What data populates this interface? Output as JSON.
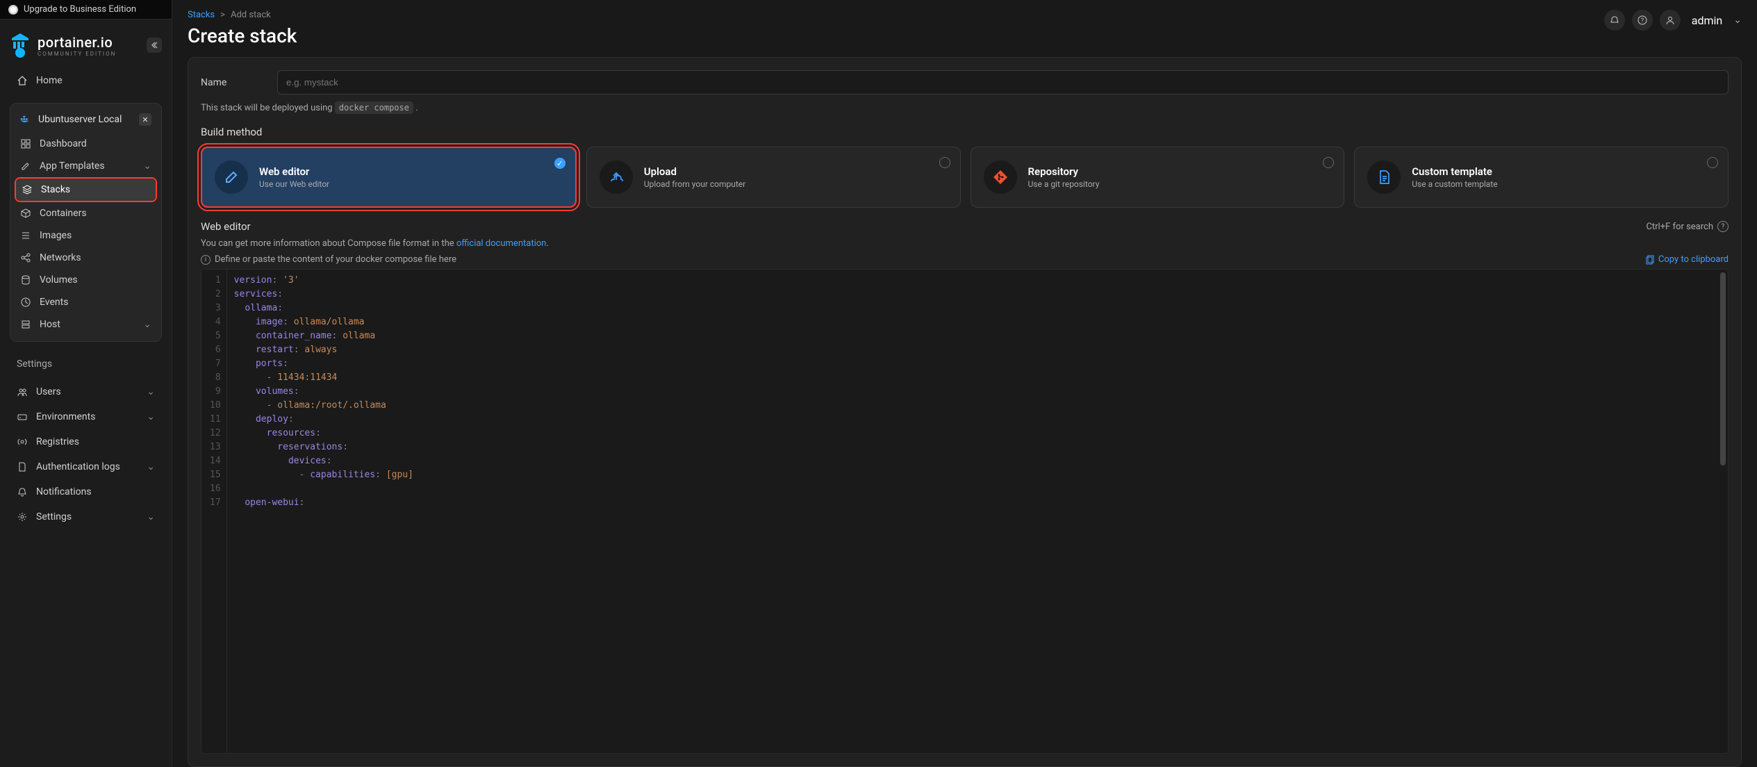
{
  "upgrade": {
    "label": "Upgrade to Business Edition"
  },
  "brand": {
    "name": "portainer.io",
    "subtitle": "COMMUNITY EDITION"
  },
  "nav": {
    "home": "Home",
    "env_name": "Ubuntuserver Local",
    "items": {
      "dashboard": "Dashboard",
      "app_templates": "App Templates",
      "stacks": "Stacks",
      "containers": "Containers",
      "images": "Images",
      "networks": "Networks",
      "volumes": "Volumes",
      "events": "Events",
      "host": "Host"
    },
    "settings_label": "Settings",
    "settings": {
      "users": "Users",
      "environments": "Environments",
      "registries": "Registries",
      "auth_logs": "Authentication logs",
      "notifications": "Notifications",
      "settings": "Settings"
    }
  },
  "header": {
    "breadcrumb_stacks": "Stacks",
    "breadcrumb_sep": ">",
    "breadcrumb_add": "Add stack",
    "title": "Create stack",
    "user": "admin"
  },
  "form": {
    "name_label": "Name",
    "name_placeholder": "e.g. mystack",
    "deploy_hint_a": "This stack will be deployed using ",
    "deploy_hint_code": "docker compose",
    "deploy_hint_b": " .",
    "build_method_label": "Build method",
    "methods": {
      "web": {
        "title": "Web editor",
        "desc": "Use our Web editor"
      },
      "upload": {
        "title": "Upload",
        "desc": "Upload from your computer"
      },
      "repo": {
        "title": "Repository",
        "desc": "Use a git repository"
      },
      "custom": {
        "title": "Custom template",
        "desc": "Use a custom template"
      }
    },
    "editor_title": "Web editor",
    "search_hint": "Ctrl+F for search",
    "info_a": "You can get more information about Compose file format in the ",
    "info_link": "official documentation",
    "info_b": ".",
    "define_hint": "Define or paste the content of your docker compose file here",
    "copy_btn": "Copy to clipboard"
  },
  "code": {
    "lines": [
      "1",
      "2",
      "3",
      "4",
      "5",
      "6",
      "7",
      "8",
      "9",
      "10",
      "11",
      "12",
      "13",
      "14",
      "15",
      "16",
      "17"
    ],
    "l1_a": "version",
    "l1_b": "'3'",
    "l2": "services",
    "l3": "ollama",
    "l4_a": "image",
    "l4_b": "ollama/ollama",
    "l5_a": "container_name",
    "l5_b": "ollama",
    "l6_a": "restart",
    "l6_b": "always",
    "l7": "ports",
    "l8": "11434:11434",
    "l9": "volumes",
    "l10": "ollama:/root/.ollama",
    "l11": "deploy",
    "l12": "resources",
    "l13": "reservations",
    "l14": "devices",
    "l15_a": "capabilities",
    "l15_b": "[gpu]",
    "l17": "open-webui"
  }
}
